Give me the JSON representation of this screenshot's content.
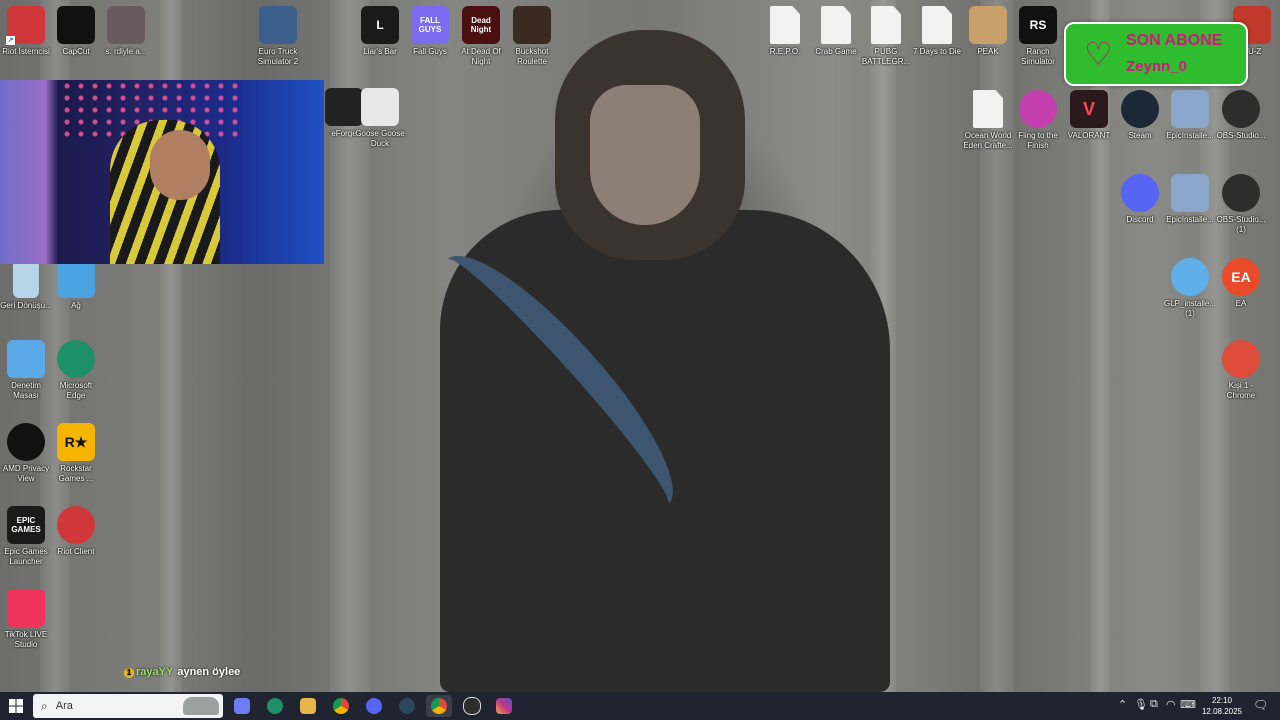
{
  "desktop_icons": [
    {
      "label": "Riot İstemcisi",
      "glyph": "",
      "color": "#d13639"
    },
    {
      "label": "CapCut",
      "glyph": "",
      "color": "#111111"
    },
    {
      "label": "s. rdiyle a...",
      "glyph": "",
      "color": "#6a5a60"
    },
    {
      "label": "Euro Truck Simulator 2",
      "glyph": "",
      "color": "#3b5e8a"
    },
    {
      "label": "Liar's Bar",
      "glyph": "L",
      "color": "#1a1a1a"
    },
    {
      "label": "Fall Guys",
      "glyph": "FALL GUYS",
      "color": "#7b6cf0"
    },
    {
      "label": "At Dead Of Night",
      "glyph": "Dead Night",
      "color": "#4a1010"
    },
    {
      "label": "Buckshot Roulette",
      "glyph": "",
      "color": "#3a2a20"
    },
    {
      "label": "R.E.P.O.",
      "glyph": "",
      "color": "#f2f2f2"
    },
    {
      "label": "Crab Game",
      "glyph": "",
      "color": "#f2f2f2"
    },
    {
      "label": "PUBG BATTLEGR...",
      "glyph": "",
      "color": "#f2f2f2"
    },
    {
      "label": "7 Days to Die",
      "glyph": "",
      "color": "#f2f2f2"
    },
    {
      "label": "PEAK",
      "glyph": "",
      "color": "#c9a06a"
    },
    {
      "label": "Ranch Simulator",
      "glyph": "RS",
      "color": "#111111"
    },
    {
      "label": "PU-Z",
      "glyph": "",
      "color": "#c0392b"
    },
    {
      "label": "eForge",
      "glyph": "",
      "color": "#222222"
    },
    {
      "label": "Goose Goose Duck",
      "glyph": "",
      "color": "#e8e8e8"
    },
    {
      "label": "Ocean World Eden Crafte...",
      "glyph": "",
      "color": "#f2f2f2"
    },
    {
      "label": "Fling to the Finish",
      "glyph": "",
      "color": "#c43fae"
    },
    {
      "label": "VALORANT",
      "glyph": "V",
      "color": "#2a1a1e"
    },
    {
      "label": "Steam",
      "glyph": "",
      "color": "#1b2838"
    },
    {
      "label": "EpicInstalle...",
      "glyph": "",
      "color": "#8aa6c8"
    },
    {
      "label": "OBS-Studio...",
      "glyph": "",
      "color": "#2d2d2d"
    },
    {
      "label": "Discord",
      "glyph": "",
      "color": "#5865f2"
    },
    {
      "label": "EpicInstalle...",
      "glyph": "",
      "color": "#8aa6c8"
    },
    {
      "label": "OBS-Studio... (1)",
      "glyph": "",
      "color": "#2d2d2d"
    },
    {
      "label": "Geri Dönüşü...",
      "glyph": "",
      "color": "#b8d4e8"
    },
    {
      "label": "Ağ",
      "glyph": "",
      "color": "#4aa3e0"
    },
    {
      "label": "GLP_installe... (1)",
      "glyph": "",
      "color": "#5fb0e8"
    },
    {
      "label": "EA",
      "glyph": "EA",
      "color": "#e84a2a"
    },
    {
      "label": "Denetim Masası",
      "glyph": "",
      "color": "#5aa9e6"
    },
    {
      "label": "Microsoft Edge",
      "glyph": "",
      "color": "#1f8f6a"
    },
    {
      "label": "Kişi 1 - Chrome",
      "glyph": "",
      "color": "#dd4b39"
    },
    {
      "label": "AMD Privacy View",
      "glyph": "",
      "color": "#111111"
    },
    {
      "label": "Rockstar Games ...",
      "glyph": "R★",
      "color": "#f4b400"
    },
    {
      "label": "Epic Games Launcher",
      "glyph": "EPIC GAMES",
      "color": "#1a1a1a"
    },
    {
      "label": "Riot Client",
      "glyph": "",
      "color": "#d13639"
    },
    {
      "label": "TikTok LIVE Studio",
      "glyph": "",
      "color": "#f0335b"
    }
  ],
  "alert": {
    "title": "SON ABONE",
    "name": "Zeynn_0"
  },
  "chat": {
    "badge": "1",
    "user": "raya",
    "user2": "YY",
    "message": "aynen öylee"
  },
  "taskbar": {
    "search_placeholder": "Ara",
    "apps": [
      {
        "name": "copilot",
        "color": "#6f7cf2"
      },
      {
        "name": "edge",
        "color": "#1f8f6a"
      },
      {
        "name": "file-explorer",
        "color": "#e8b64a"
      },
      {
        "name": "chrome",
        "color": "#dd4b39"
      },
      {
        "name": "discord",
        "color": "#5865f2"
      },
      {
        "name": "steam",
        "color": "#2a475e"
      },
      {
        "name": "chrome-profile",
        "color": "#dd4b39"
      },
      {
        "name": "obs",
        "color": "#2d2d2d"
      },
      {
        "name": "instagram",
        "color": "#c13584"
      }
    ],
    "time": "22:10",
    "date": "12.08.2025"
  }
}
